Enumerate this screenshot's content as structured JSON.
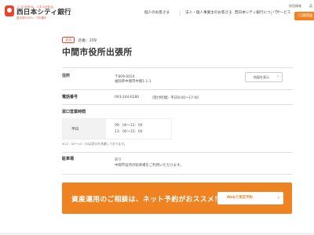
{
  "header": {
    "logo": {
      "tagline": "ココロがある。コタエがある。",
      "name": "西日本シティ銀行",
      "group": "西日本FHグループの銀行"
    },
    "nav": [
      "個人のお客さま",
      "法人・個人事業主のお客さま",
      "西日本シティ銀行について",
      "サービス"
    ],
    "util_links": [
      "採用情報",
      "英"
    ],
    "cta_label": "口座開設"
  },
  "store": {
    "category_tag": "支店",
    "store_no": "店番：209",
    "title": "中間市役所出張所"
  },
  "info": {
    "address_label": "住所",
    "postal": "〒809-0024",
    "address": "福岡県中間市中間1-1-1",
    "map_button": "地図を表示",
    "phone_label": "電話番号",
    "phone": "093-244-6280",
    "phone_hours": "（受付時間）平日9:00～17:00",
    "hours_label": "窓口営業時間",
    "hours_day": "平日",
    "hours_am": "09：00～12：00",
    "hours_pm": "13：00～15：00",
    "hours_note": "※12：00～13：00は窓口を休業しております。",
    "parking_label": "駐車場",
    "parking_value": "あり",
    "parking_note": "中間市役所の駐車場をご利用いただけます。"
  },
  "cta_banner": {
    "text": "資産運用のご相談は、ネット予約がおススメ！",
    "button": "Webで来店予約"
  },
  "colors": {
    "accent": "#f08321",
    "brand_red": "#e8452b"
  }
}
